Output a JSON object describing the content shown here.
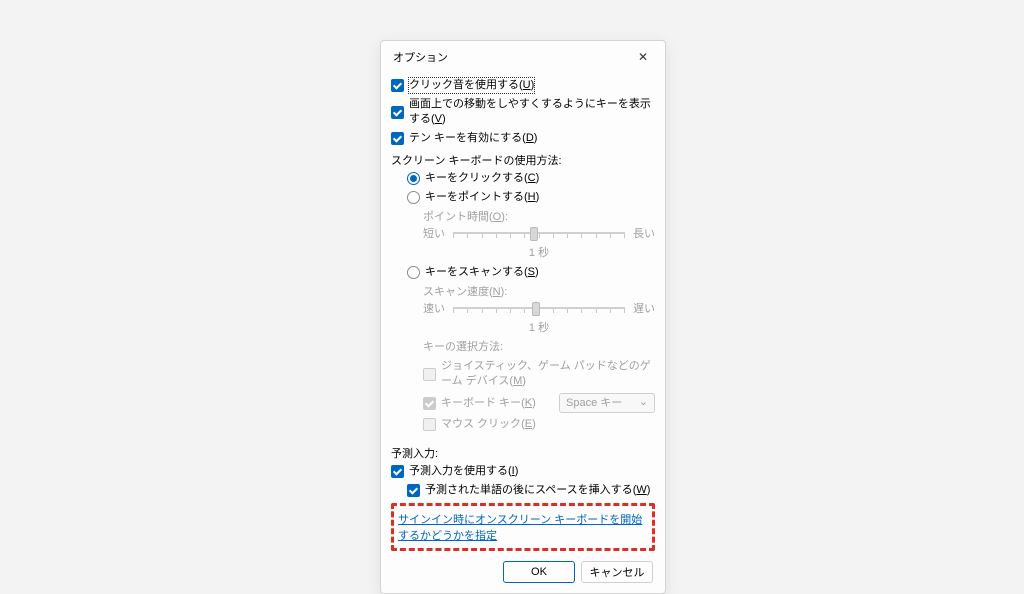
{
  "dialog": {
    "title": "オプション",
    "checkboxes": {
      "clickSound": {
        "label": "クリック音を使用する",
        "accel": "U"
      },
      "showKeys": {
        "label": "画面上での移動をしやすくするようにキーを表示する",
        "accel": "V"
      },
      "numericKeypad": {
        "label": "テン キーを有効にする",
        "accel": "D"
      }
    },
    "usageSection": {
      "title": "スクリーン キーボードの使用方法:",
      "radios": {
        "click": {
          "label": "キーをクリックする",
          "accel": "C"
        },
        "hover": {
          "label": "キーをポイントする",
          "accel": "H"
        },
        "scan": {
          "label": "キーをスキャンする",
          "accel": "S"
        }
      },
      "hoverSlider": {
        "label": "ポイント時間",
        "accel": "O",
        "minLabel": "短い",
        "maxLabel": "長い",
        "value": "1 秒"
      },
      "scanSlider": {
        "label": "スキャン速度",
        "accel": "N",
        "minLabel": "速い",
        "maxLabel": "遅い",
        "value": "1 秒"
      },
      "selectMethod": {
        "title": "キーの選択方法:",
        "joystick": {
          "label": "ジョイスティック、ゲーム パッドなどのゲーム デバイス",
          "accel": "M"
        },
        "keyboard": {
          "label": "キーボード キー",
          "accel": "K",
          "dropdown": "Space キー"
        },
        "mouse": {
          "label": "マウス クリック",
          "accel": "E"
        }
      }
    },
    "predictSection": {
      "title": "予測入力:",
      "usePrediction": {
        "label": "予測入力を使用する",
        "accel": "I"
      },
      "insertSpace": {
        "label": "予測された単語の後にスペースを挿入する",
        "accel": "W"
      }
    },
    "signinLink": "サインイン時にオンスクリーン キーボードを開始するかどうかを指定",
    "buttons": {
      "ok": "OK",
      "cancel": "キャンセル"
    }
  }
}
